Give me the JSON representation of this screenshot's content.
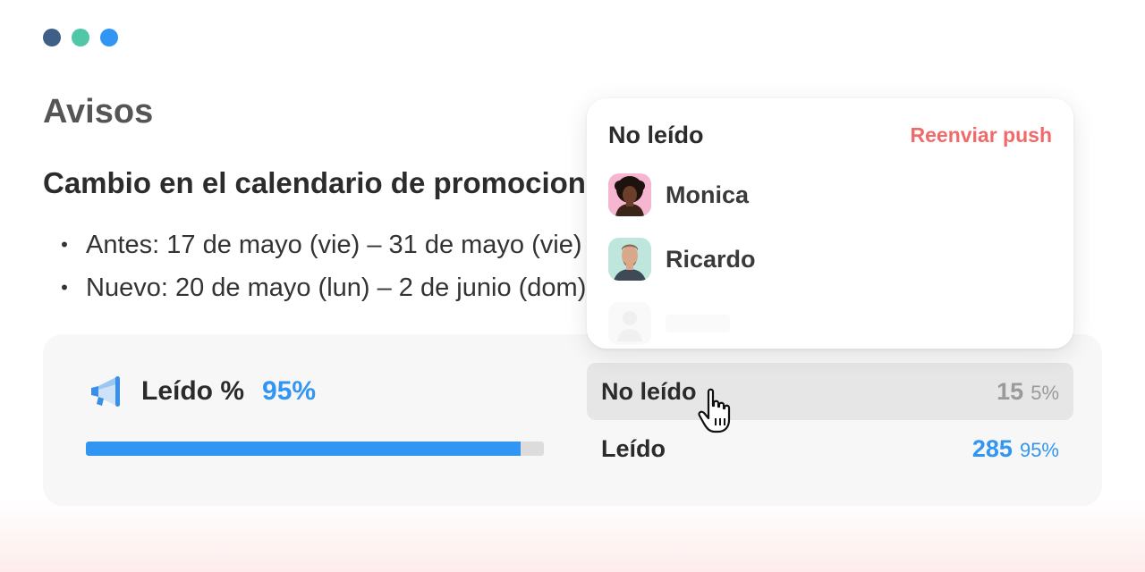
{
  "window": {
    "controls": [
      "dot-dark-blue",
      "dot-green",
      "dot-blue"
    ]
  },
  "page": {
    "title": "Avisos"
  },
  "notice": {
    "title": "Cambio en el calendario de promociones",
    "items": [
      "Antes: 17 de mayo (vie) – 31 de mayo (vie)",
      "Nuevo: 20 de mayo (lun) – 2 de junio (dom)"
    ]
  },
  "stats": {
    "icon": "megaphone-icon",
    "read_label": "Leído %",
    "read_percent": "95%",
    "read_fraction": 0.95,
    "rows": [
      {
        "label": "No leído",
        "count": "15",
        "percent": "5%"
      },
      {
        "label": "Leído",
        "count": "285",
        "percent": "95%"
      }
    ]
  },
  "popover": {
    "title": "No leído",
    "action": "Reenviar push",
    "users": [
      {
        "name": "Monica",
        "avatar": "avatar-monica"
      },
      {
        "name": "Ricardo",
        "avatar": "avatar-ricardo"
      }
    ]
  },
  "colors": {
    "accent": "#3196f3",
    "danger": "#f06a6a",
    "dot1": "#3f5f86",
    "dot2": "#52c7a8",
    "dot3": "#3196f3"
  },
  "cursor": "hand-pointer-icon"
}
